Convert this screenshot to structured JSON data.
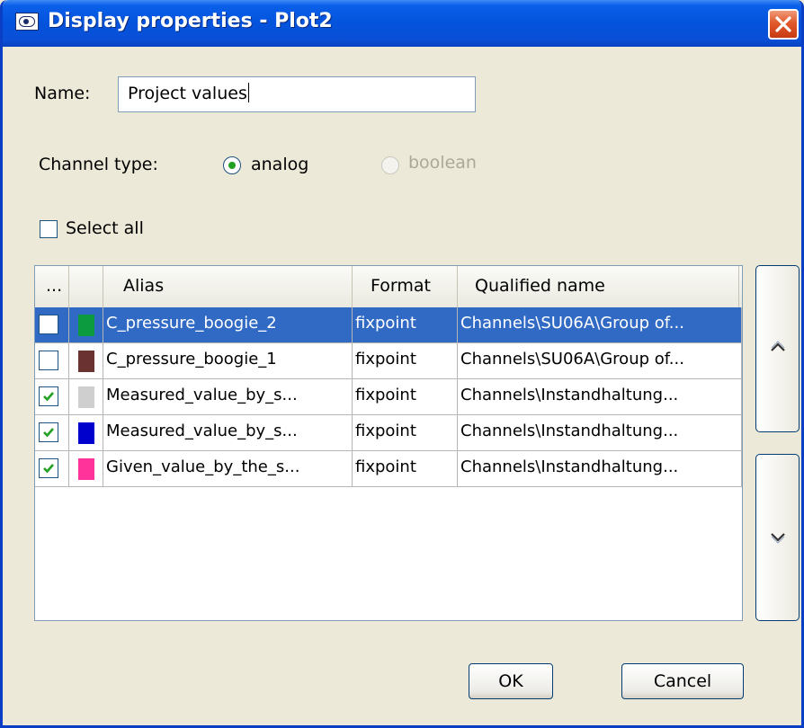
{
  "window": {
    "title": "Display properties - Plot2"
  },
  "name_field": {
    "label": "Name:",
    "value": "Project values"
  },
  "channel_type": {
    "label": "Channel type:",
    "options": [
      {
        "label": "analog",
        "selected": true,
        "enabled": true
      },
      {
        "label": "boolean",
        "selected": false,
        "enabled": false
      }
    ]
  },
  "select_all": {
    "label": "Select all",
    "checked": false
  },
  "table": {
    "columns": [
      "...",
      "",
      "Alias",
      "Format",
      "Qualified name"
    ],
    "rows": [
      {
        "checked": false,
        "color": "#0c9b3f",
        "alias": "C_pressure_boogie_2",
        "format": "fixpoint",
        "qualified_name": "Channels\\SU06A\\Group of...",
        "selected": true
      },
      {
        "checked": false,
        "color": "#6b3232",
        "alias": "C_pressure_boogie_1",
        "format": "fixpoint",
        "qualified_name": "Channels\\SU06A\\Group of...",
        "selected": false
      },
      {
        "checked": true,
        "color": "#cfcfcf",
        "alias": "Measured_value_by_s...",
        "format": "fixpoint",
        "qualified_name": "Channels\\Instandhaltung...",
        "selected": false
      },
      {
        "checked": true,
        "color": "#0000cc",
        "alias": "Measured_value_by_s...",
        "format": "fixpoint",
        "qualified_name": "Channels\\Instandhaltung...",
        "selected": false
      },
      {
        "checked": true,
        "color": "#ff3399",
        "alias": "Given_value_by_the_s...",
        "format": "fixpoint",
        "qualified_name": "Channels\\Instandhaltung...",
        "selected": false
      }
    ]
  },
  "side_buttons": {
    "up_icon": "chevron-up-icon",
    "down_icon": "chevron-down-icon"
  },
  "buttons": {
    "ok": "OK",
    "cancel": "Cancel"
  },
  "colors": {
    "titlebar": "#0453dd",
    "selection": "#316ac5",
    "dialog_bg": "#ece9d8"
  }
}
